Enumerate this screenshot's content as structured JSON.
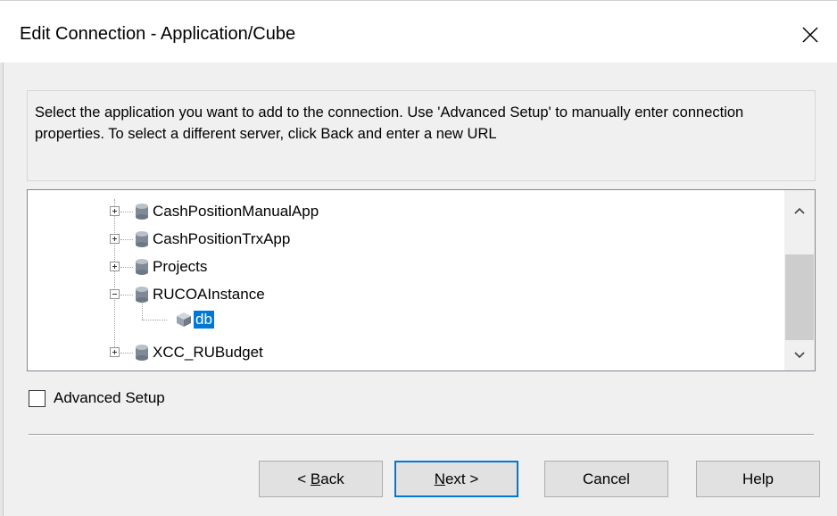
{
  "dialog": {
    "title": "Edit Connection - Application/Cube",
    "description": "Select the application you want to add to the connection. Use 'Advanced Setup' to manually enter connection properties. To select a different server, click Back and enter a new URL"
  },
  "tree": {
    "items": [
      {
        "label": "CashPositionManualApp",
        "expanded": false,
        "icon": "database-icon"
      },
      {
        "label": "CashPositionTrxApp",
        "expanded": false,
        "icon": "database-icon"
      },
      {
        "label": "Projects",
        "expanded": false,
        "icon": "database-icon"
      },
      {
        "label": "RUCOAInstance",
        "expanded": true,
        "icon": "database-icon"
      },
      {
        "label": "db",
        "selected": true,
        "icon": "cube-icon"
      },
      {
        "label": "XCC_RUBudget",
        "expanded": false,
        "icon": "database-icon"
      }
    ]
  },
  "options": {
    "advanced_setup_label": "Advanced Setup",
    "advanced_setup_checked": false
  },
  "buttons": {
    "back_prefix": "< ",
    "back_key": "B",
    "back_rest": "ack",
    "next_key": "N",
    "next_rest": "ext >",
    "cancel": "Cancel",
    "help": "Help"
  },
  "colors": {
    "selection": "#0078d7",
    "default_button_border": "#0078d7"
  }
}
